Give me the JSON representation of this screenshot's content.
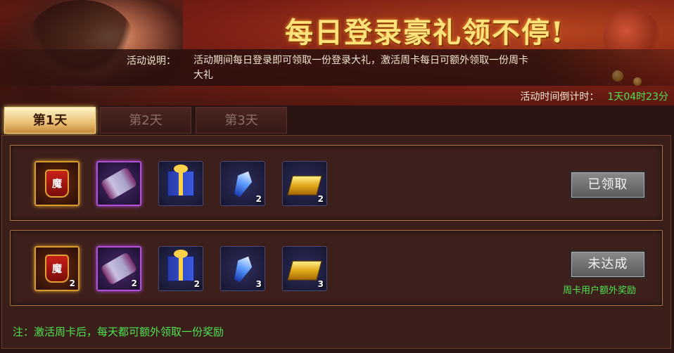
{
  "banner": {
    "title": "每日登录豪礼领不停!",
    "desc_label": "活动说明：",
    "desc_text": "活动期间每日登录即可领取一份登录大礼，激活周卡每日可额外领取一份周卡大礼",
    "countdown_label": "活动时间倒计时：",
    "countdown_value": "1天04时23分"
  },
  "tabs": [
    {
      "label": "第1天",
      "active": true
    },
    {
      "label": "第2天",
      "active": false
    },
    {
      "label": "第3天",
      "active": false
    }
  ],
  "rows": [
    {
      "items": [
        {
          "icon": "bag-icon",
          "count": ""
        },
        {
          "icon": "scroll-icon",
          "count": ""
        },
        {
          "icon": "gift-icon",
          "count": ""
        },
        {
          "icon": "crystal-icon",
          "count": "2"
        },
        {
          "icon": "gold-icon",
          "count": "2"
        }
      ],
      "button": "已领取"
    },
    {
      "items": [
        {
          "icon": "bag-icon",
          "count": "2"
        },
        {
          "icon": "scroll-icon",
          "count": "2"
        },
        {
          "icon": "gift-icon",
          "count": "2"
        },
        {
          "icon": "crystal-icon",
          "count": "3"
        },
        {
          "icon": "gold-icon",
          "count": "3"
        }
      ],
      "button": "未达成",
      "note": "周卡用户额外奖励"
    }
  ],
  "footer": "注：激活周卡后，每天都可额外领取一份奖励",
  "colors": {
    "accent_green": "#4fe24f",
    "title_gold": "#ffe27a",
    "border_gold": "#a9733c"
  }
}
